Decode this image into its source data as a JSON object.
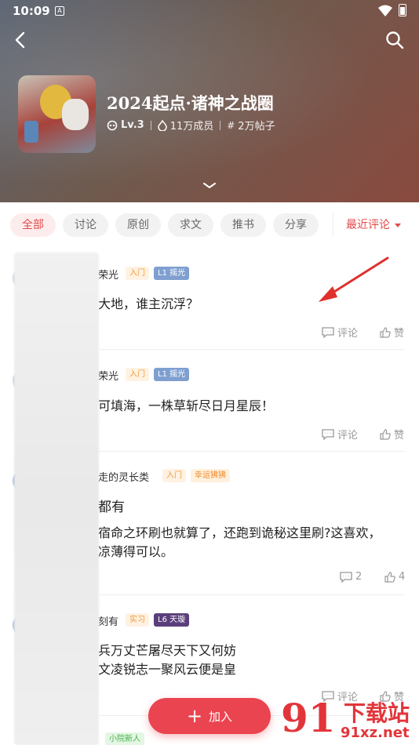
{
  "status_bar": {
    "time": "10:09",
    "notif_icon_text": "A"
  },
  "header": {
    "title": "2024起点·诸神之战圈",
    "level": "Lv.3",
    "members": "11万成员",
    "posts": "2万帖子",
    "background_color": "#6f5a4e"
  },
  "tabs": [
    {
      "label": "全部",
      "active": true
    },
    {
      "label": "讨论",
      "active": false
    },
    {
      "label": "原创",
      "active": false
    },
    {
      "label": "求文",
      "active": false
    },
    {
      "label": "推书",
      "active": false
    },
    {
      "label": "分享",
      "active": false
    }
  ],
  "sort": {
    "label": "最近评论"
  },
  "posts": [
    {
      "name": "荣光",
      "badges": [
        "入门",
        "L1 摇光"
      ],
      "lines": [
        "大地，谁主沉浮？"
      ],
      "comment": "评论",
      "like": "赞"
    },
    {
      "name": "荣光",
      "badges": [
        "入门",
        "L1 摇光"
      ],
      "lines": [
        "可填海，一株草斩尽日月星辰！"
      ],
      "comment": "评论",
      "like": "赞"
    },
    {
      "name": "走的灵长类",
      "badges": [
        "入门",
        "幸运狒狒"
      ],
      "lines": [
        "都有",
        "宿命之环刷也就算了，还跑到诡秘这里刷?这喜欢，",
        "凉薄得可以。"
      ],
      "comment": "2",
      "like": "4"
    },
    {
      "name": "刻有",
      "badges": [
        "实习",
        "L6 天璇"
      ],
      "lines": [
        "兵万丈芒屠尽天下又何妨",
        "文凌锐志一聚风云便是皇"
      ],
      "comment": "评论",
      "like": "赞"
    },
    {
      "name": "",
      "badges": [
        "小院新人"
      ],
      "lines": [],
      "comment": "",
      "like": ""
    }
  ],
  "join_button": {
    "label": "加入"
  },
  "watermark": {
    "logo": "91",
    "title": "下载站",
    "url": "91xz.net"
  },
  "colors": {
    "accent": "#e24a4a",
    "join": "#ea4450"
  }
}
